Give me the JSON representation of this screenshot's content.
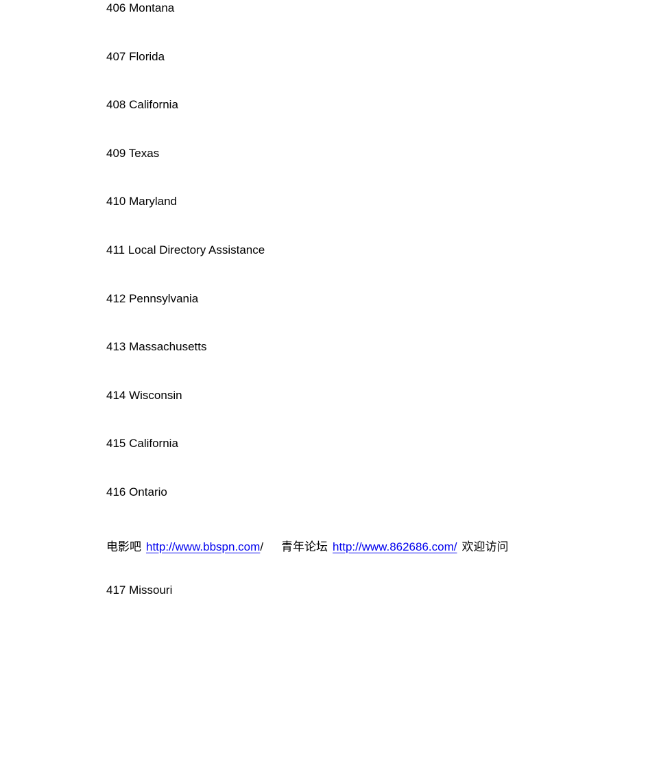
{
  "document": {
    "type": "area-code-directory",
    "background_color": "#ffffff",
    "text_color": "#000000",
    "link_color": "#0000ee"
  },
  "entries_before_promo": [
    {
      "code": "406",
      "location": "Montana",
      "text": "406 Montana"
    },
    {
      "code": "407",
      "location": "Florida",
      "text": "407 Florida"
    },
    {
      "code": "408",
      "location": "California",
      "text": "408 California"
    },
    {
      "code": "409",
      "location": "Texas",
      "text": "409 Texas"
    },
    {
      "code": "410",
      "location": "Maryland",
      "text": "410 Maryland"
    },
    {
      "code": "411",
      "location": "Local Directory Assistance",
      "text": "411 Local Directory Assistance"
    },
    {
      "code": "412",
      "location": "Pennsylvania",
      "text": "412 Pennsylvania"
    },
    {
      "code": "413",
      "location": "Massachusetts",
      "text": "413 Massachusetts"
    },
    {
      "code": "414",
      "location": "Wisconsin",
      "text": "414 Wisconsin"
    },
    {
      "code": "415",
      "location": "California",
      "text": "415 California"
    },
    {
      "code": "416",
      "location": "Ontario",
      "text": "416 Ontario"
    }
  ],
  "promo": {
    "site1_label": "电影吧",
    "site1_url": "http://www.bbspn.com",
    "site1_trailing_slash": "/",
    "site2_label": "青年论坛",
    "site2_url": "http://www.862686.com/",
    "welcome_text": "欢迎访问"
  },
  "entries_after_promo": [
    {
      "code": "417",
      "location": "Missouri",
      "text": "417 Missouri"
    }
  ]
}
